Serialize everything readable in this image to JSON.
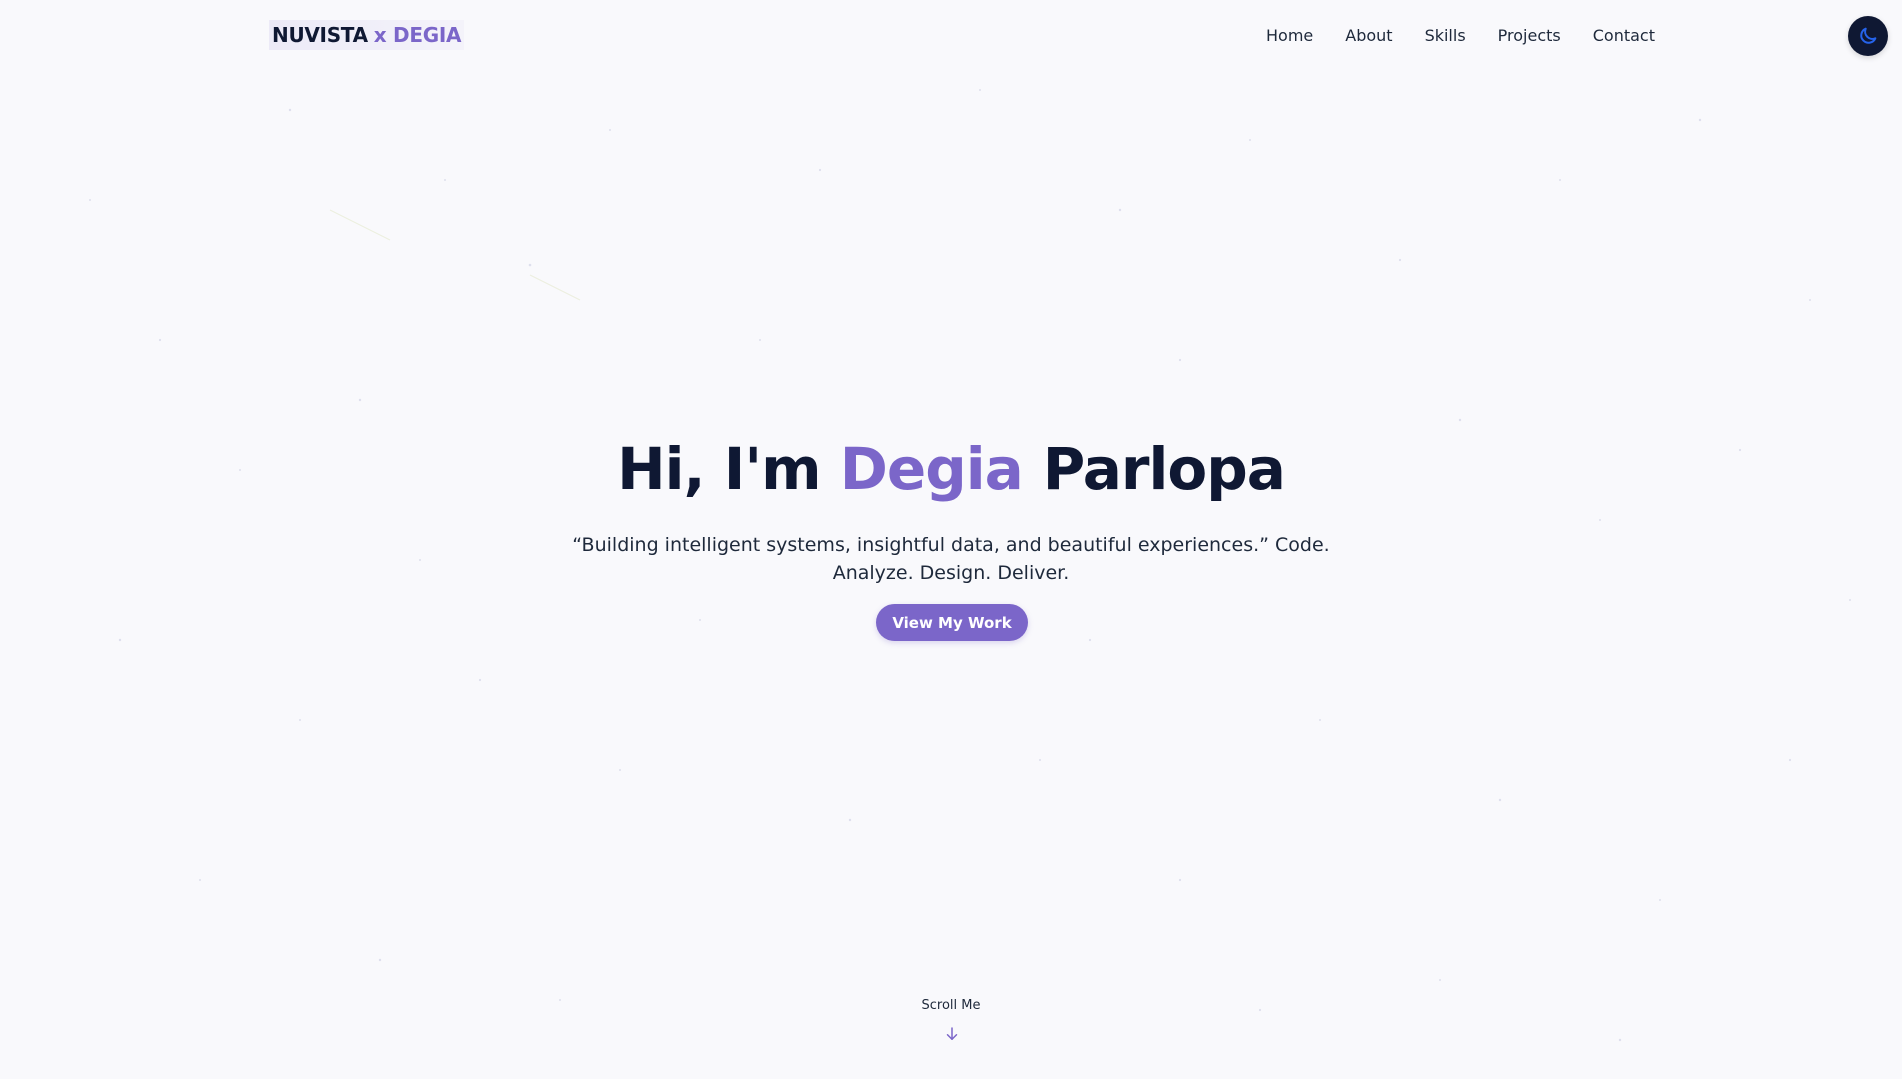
{
  "header": {
    "brand_part1": "NUVISTA",
    "brand_part2": "x DEGIA",
    "nav": [
      "Home",
      "About",
      "Skills",
      "Projects",
      "Contact"
    ],
    "theme_toggle_icon": "moon-icon"
  },
  "hero": {
    "greeting": "Hi, I'm",
    "first_name": "Degia",
    "last_name": "Parlopa",
    "tagline": "“Building intelligent systems, insightful data, and beautiful experiences.” Code. Analyze. Design. Deliver.",
    "cta_label": "View My Work"
  },
  "scroll": {
    "label": "Scroll Me",
    "icon": "arrow-down-icon"
  },
  "colors": {
    "background": "#f9f9fc",
    "accent": "#7b66c9",
    "text_dark": "#0f1833",
    "toggle_bg": "#0f1833",
    "toggle_icon": "#2563eb"
  }
}
